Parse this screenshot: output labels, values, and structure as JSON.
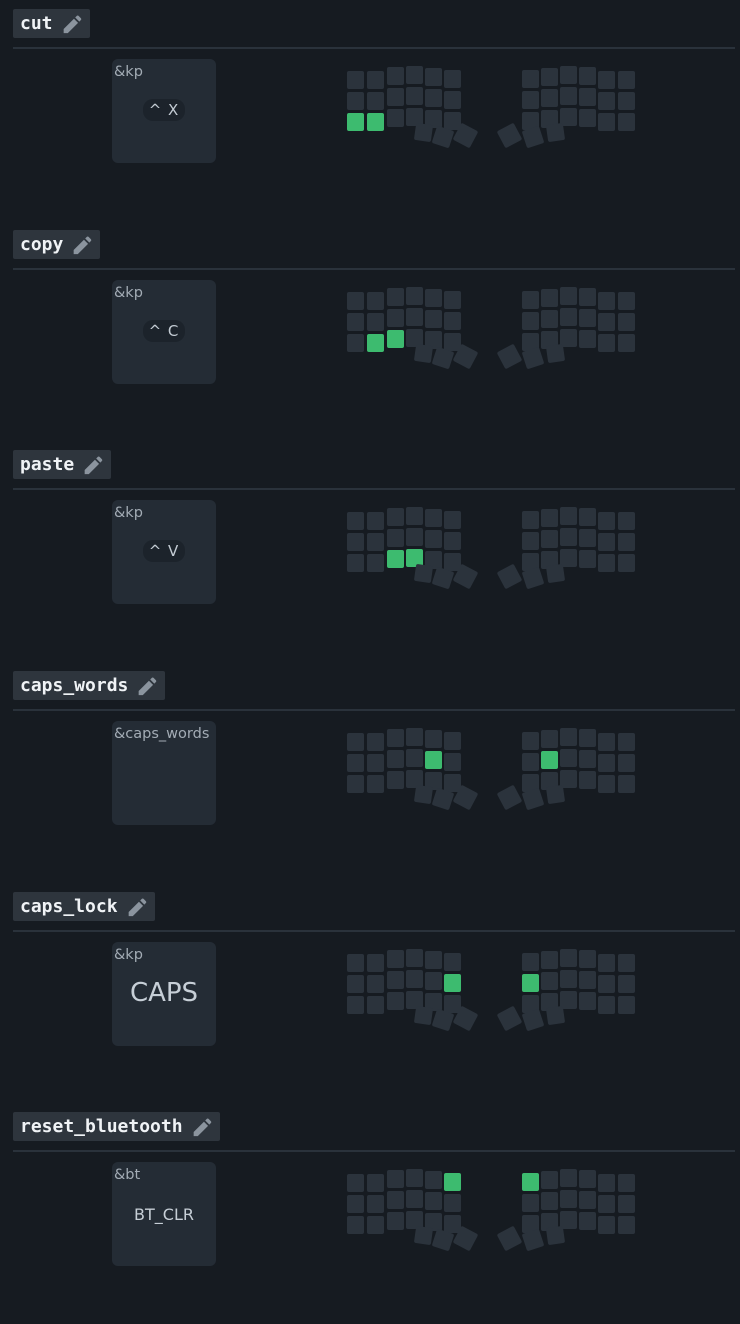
{
  "combos": [
    {
      "name": "cut",
      "behavior": "&kp",
      "param": "^ X",
      "param_style": "chip",
      "active_keys": [
        24,
        25
      ]
    },
    {
      "name": "copy",
      "behavior": "&kp",
      "param": "^ C",
      "param_style": "chip",
      "active_keys": [
        25,
        26
      ]
    },
    {
      "name": "paste",
      "behavior": "&kp",
      "param": "^ V",
      "param_style": "chip",
      "active_keys": [
        26,
        27
      ]
    },
    {
      "name": "caps_words",
      "behavior": "&caps_words",
      "param": "",
      "param_style": "none",
      "active_keys": [
        16,
        19
      ]
    },
    {
      "name": "caps_lock",
      "behavior": "&kp",
      "param": "CAPS",
      "param_style": "big",
      "active_keys": [
        17,
        18
      ]
    },
    {
      "name": "reset_bluetooth",
      "behavior": "&bt",
      "param": "BT_CLR",
      "param_style": "mid",
      "active_keys": [
        5,
        6
      ]
    }
  ],
  "colors": {
    "background": "#161b21",
    "key_inactive": "#2b333c",
    "key_active": "#3dbb6f",
    "name_tag": "#2e353d",
    "card": "#242c35"
  },
  "icons": {
    "edit": "pencil-icon"
  }
}
